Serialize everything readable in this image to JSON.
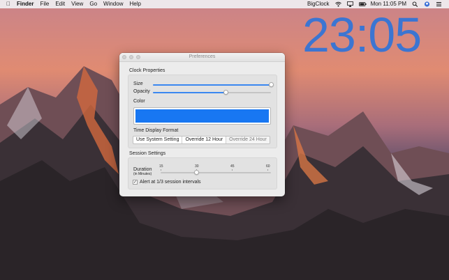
{
  "menubar": {
    "apple_icon": "apple-icon",
    "app_name": "Finder",
    "menus": [
      "File",
      "Edit",
      "View",
      "Go",
      "Window",
      "Help"
    ],
    "status_app": "BigClock",
    "datetime": "Mon 11:05 PM",
    "icons": [
      "wifi-icon",
      "airplay-icon",
      "battery-icon",
      "search-icon",
      "user-icon",
      "control-center-icon"
    ]
  },
  "desktop_clock": {
    "time": "23:05",
    "color": "#2f74d9"
  },
  "window": {
    "title": "Preferences",
    "clock_properties": {
      "section_title": "Clock Properties",
      "size_label": "Size",
      "size_value": 1.0,
      "opacity_label": "Opacity",
      "opacity_value": 0.62,
      "color_label": "Color",
      "color_value": "#1877f2",
      "time_format_label": "Time Display Format",
      "time_format_options": [
        "Use System Setting",
        "Override 12 Hour",
        "Override 24 Hour"
      ],
      "time_format_selected": "Use System Setting"
    },
    "session_settings": {
      "section_title": "Session Settings",
      "duration_label": "Duration",
      "duration_unit": "(in Minutes)",
      "duration_ticks": [
        "15",
        "30",
        "45",
        "60"
      ],
      "duration_value": 30,
      "alert_label": "Alert at 1/3 session intervals",
      "alert_checked": "✓"
    }
  },
  "accent_color": "#3a87f0"
}
